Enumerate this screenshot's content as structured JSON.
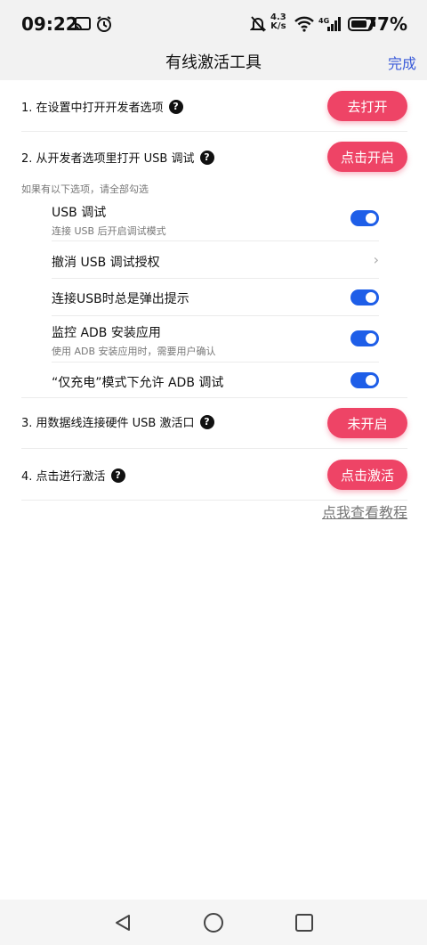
{
  "status_bar": {
    "time": "09:22",
    "net_speed_value": "4.3",
    "net_speed_unit": "K/s",
    "battery_pct": "77%",
    "icons": [
      "cast-icon",
      "alarm-icon",
      "mute-icon",
      "wifi-icon",
      "signal-icon",
      "battery-icon"
    ]
  },
  "header": {
    "title": "有线激活工具",
    "done_label": "完成"
  },
  "steps": [
    {
      "label": "1. 在设置中打开开发者选项",
      "button": "去打开"
    },
    {
      "label": "2. 从开发者选项里打开 USB 调试",
      "button": "点击开启"
    },
    {
      "label": "3. 用数据线连接硬件 USB 激活口",
      "button": "未开启"
    },
    {
      "label": "4. 点击进行激活",
      "button": "点击激活"
    }
  ],
  "hint": "如果有以下选项，请全部勾选",
  "options": [
    {
      "title": "USB 调试",
      "subtitle": "连接 USB 后开启调试模式",
      "control": "toggle",
      "on": true
    },
    {
      "title": "撤消 USB 调试授权",
      "subtitle": "",
      "control": "chevron"
    },
    {
      "title": "连接USB时总是弹出提示",
      "subtitle": "",
      "control": "toggle",
      "on": true
    },
    {
      "title": "监控 ADB 安装应用",
      "subtitle": "使用 ADB 安装应用时，需要用户确认",
      "control": "toggle",
      "on": true
    },
    {
      "title": "“仅充电”模式下允许 ADB 调试",
      "subtitle": "",
      "control": "toggle",
      "on": true
    }
  ],
  "tutorial_link": "点我查看教程",
  "help_glyph": "?",
  "colors": {
    "accent_pink": "#ee4466",
    "toggle_blue": "#1e5ee8",
    "done_blue": "#3a5bd9"
  }
}
